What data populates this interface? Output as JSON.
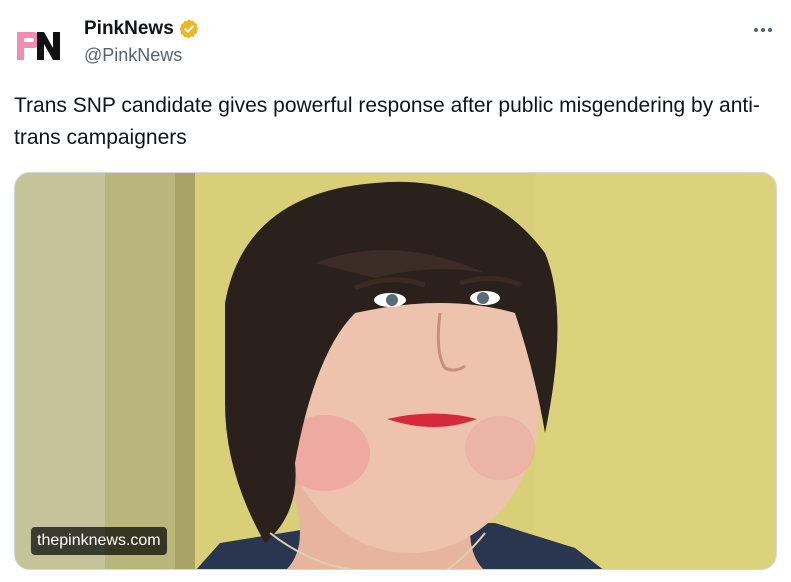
{
  "account": {
    "display_name": "PinkNews",
    "handle": "@PinkNews",
    "logo_text": "PN",
    "logo_colors": [
      "#f08db0",
      "#111111"
    ],
    "verified_badge_color": "#e8b829"
  },
  "icons": {
    "verified": "verified-badge-icon",
    "more": "more-options-icon"
  },
  "tweet": {
    "text": "Trans SNP candidate gives powerful response after public misgendering by anti-trans campaigners"
  },
  "media": {
    "domain_label": "thepinknews.com"
  }
}
